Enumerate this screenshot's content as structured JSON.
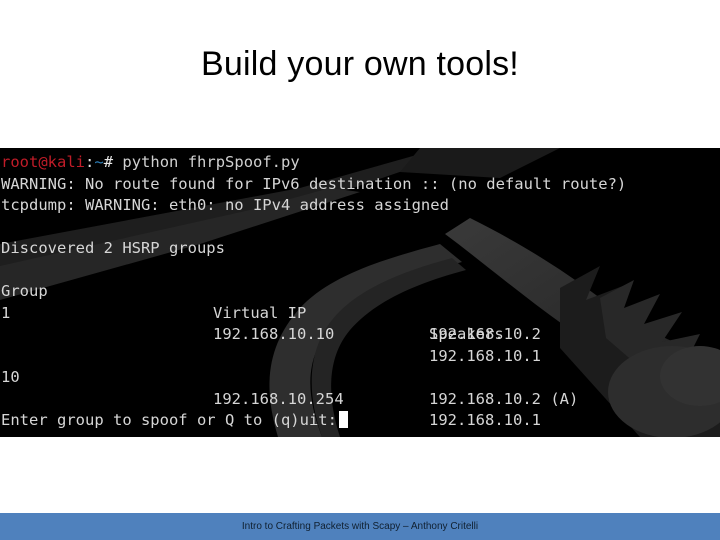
{
  "slide": {
    "title": "Build your own tools!",
    "footer": "Intro to Crafting Packets with Scapy – Anthony Critelli"
  },
  "colors": {
    "footer_bar": "#4f81bd",
    "terminal_bg": "#000000",
    "prompt_user": "#c01c28",
    "prompt_path": "#2e7fb8",
    "terminal_fg": "#d6d6d6",
    "watermark": "#2b2b2b"
  },
  "terminal": {
    "prompt": {
      "user_host": "root@kali",
      "separator": ":",
      "path": "~",
      "sigil": "#",
      "command": "python fhrpSpoof.py"
    },
    "warnings": [
      "WARNING: No route found for IPv6 destination :: (no default route?)",
      "tcpdump: WARNING: eth0: no IPv4 address assigned"
    ],
    "discovery_line": "Discovered 2 HSRP groups",
    "table": {
      "headers": [
        "Group",
        "Virtual IP",
        "Speakers"
      ],
      "rows": [
        {
          "group": "1",
          "virtual_ip": "192.168.10.10",
          "speakers": [
            "192.168.10.1",
            "192.168.10.2"
          ]
        },
        {
          "group": "10",
          "virtual_ip": "192.168.10.254",
          "speakers": [
            "192.168.10.1",
            "192.168.10.2 (A)"
          ]
        }
      ]
    },
    "input_prompt": "Enter group to spoof or Q to (q)uit:",
    "cursor": "block-cursor"
  }
}
